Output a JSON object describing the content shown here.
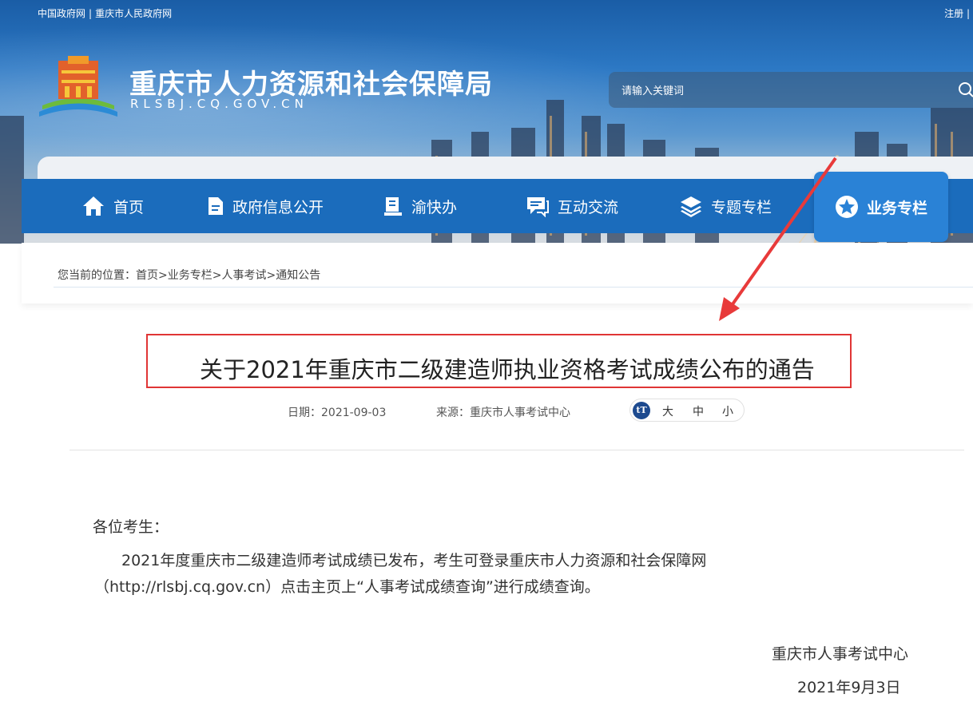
{
  "topbar": {
    "link_gov": "中国政府网",
    "separator": "|",
    "link_cq": "重庆市人民政府网",
    "right": "注册 |"
  },
  "header": {
    "title": "重庆市人力资源和社会保障局",
    "url": "RLSBJ.CQ.GOV.CN",
    "search_placeholder": "请输入关键词"
  },
  "nav": {
    "items": [
      {
        "label": "首页",
        "icon": "home-icon"
      },
      {
        "label": "政府信息公开",
        "icon": "document-icon"
      },
      {
        "label": "渝快办",
        "icon": "book-icon"
      },
      {
        "label": "互动交流",
        "icon": "chat-icon"
      },
      {
        "label": "专题专栏",
        "icon": "layers-icon"
      },
      {
        "label": "业务专栏",
        "icon": "star-icon",
        "active": true
      }
    ]
  },
  "breadcrumb": {
    "text": "您当前的位置：首页>业务专栏>人事考试>通知公告"
  },
  "article": {
    "title": "关于2021年重庆市二级建造师执业资格考试成绩公布的通告",
    "date": "日期：2021-09-03",
    "source": "来源：重庆市人事考试中心",
    "font_size": {
      "icon": "tT",
      "large": "大",
      "medium": "中",
      "small": "小"
    },
    "salutation": "各位考生：",
    "para1": "2021年度重庆市二级建造师考试成绩已发布，考生可登录重庆市人力资源和社会保障网",
    "para2": "（http://rlsbj.cq.gov.cn）点击主页上“人事考试成绩查询”进行成绩查询。",
    "signature_org": "重庆市人事考试中心",
    "signature_date": "2021年9月3日"
  },
  "colors": {
    "nav_bg": "#1b6cbc",
    "nav_active": "#2a82d6",
    "highlight_red": "#e03535"
  }
}
